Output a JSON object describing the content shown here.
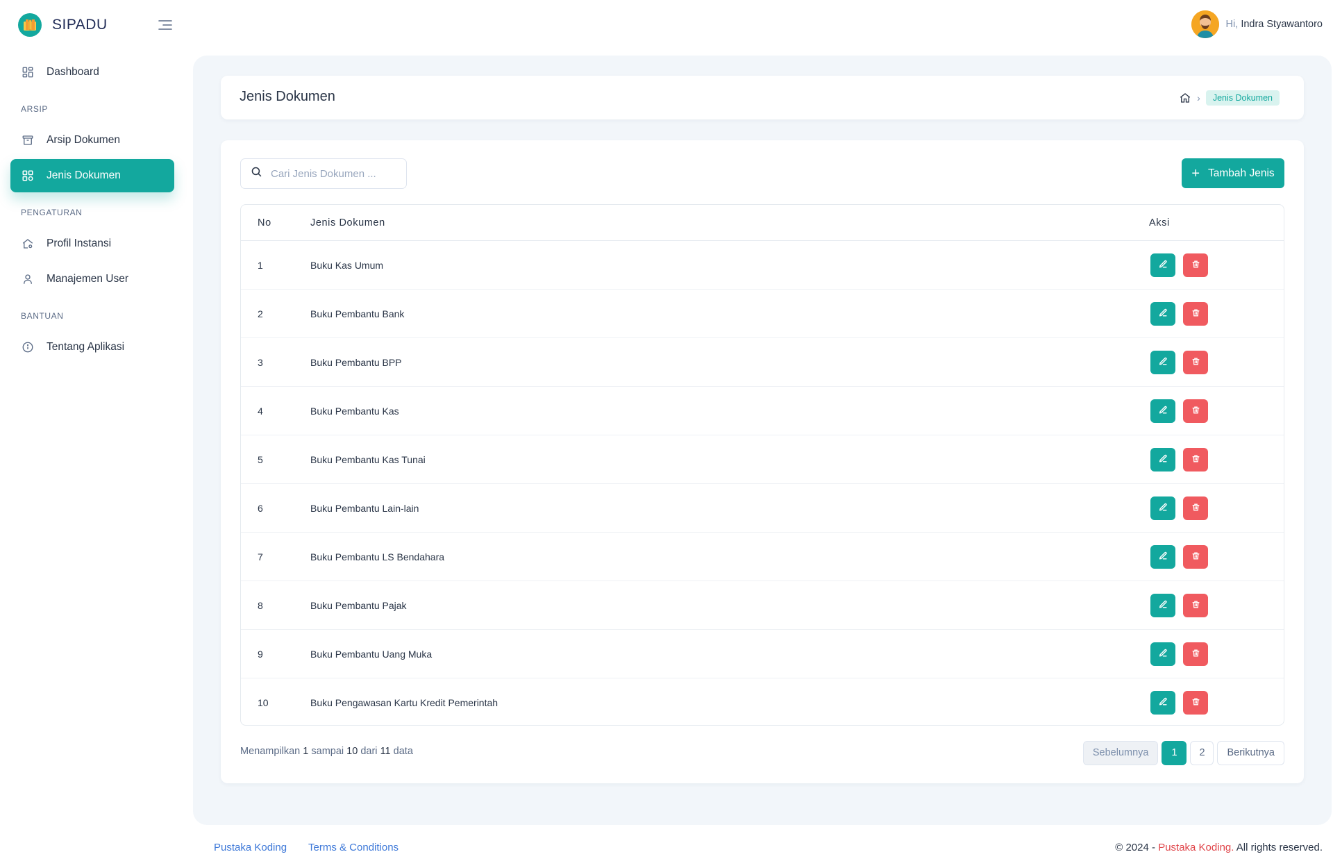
{
  "app": {
    "name": "SIPADU"
  },
  "header": {
    "greeting": "Hi,",
    "user_name": "Indra Styawantoro"
  },
  "sidebar": {
    "dashboard": "Dashboard",
    "sections": {
      "arsip": "ARSIP",
      "pengaturan": "PENGATURAN",
      "bantuan": "BANTUAN"
    },
    "items": {
      "arsip_dokumen": "Arsip Dokumen",
      "jenis_dokumen": "Jenis Dokumen",
      "profil_instansi": "Profil Instansi",
      "manajemen_user": "Manajemen User",
      "tentang_aplikasi": "Tentang Aplikasi"
    }
  },
  "page": {
    "title": "Jenis Dokumen",
    "breadcrumb_current": "Jenis Dokumen"
  },
  "search": {
    "placeholder": "Cari Jenis Dokumen ..."
  },
  "toolbar": {
    "add_icon": "+",
    "add_label": "Tambah Jenis"
  },
  "table": {
    "headers": {
      "no": "No",
      "name": "Jenis Dokumen",
      "action": "Aksi"
    },
    "rows": [
      {
        "no": "1",
        "name": "Buku Kas Umum"
      },
      {
        "no": "2",
        "name": "Buku Pembantu Bank"
      },
      {
        "no": "3",
        "name": "Buku Pembantu BPP"
      },
      {
        "no": "4",
        "name": "Buku Pembantu Kas"
      },
      {
        "no": "5",
        "name": "Buku Pembantu Kas Tunai"
      },
      {
        "no": "6",
        "name": "Buku Pembantu Lain-lain"
      },
      {
        "no": "7",
        "name": "Buku Pembantu LS Bendahara"
      },
      {
        "no": "8",
        "name": "Buku Pembantu Pajak"
      },
      {
        "no": "9",
        "name": "Buku Pembantu Uang Muka"
      },
      {
        "no": "10",
        "name": "Buku Pengawasan Kartu Kredit Pemerintah"
      }
    ]
  },
  "pagination_info": {
    "prefix": "Menampilkan",
    "from": "1",
    "mid1": "sampai",
    "to": "10",
    "mid2": "dari",
    "total": "11",
    "suffix": "data"
  },
  "pagination": {
    "prev": "Sebelumnya",
    "page1": "1",
    "page2": "2",
    "next": "Berikutnya"
  },
  "footer": {
    "link1": "Pustaka Koding",
    "link2": "Terms & Conditions",
    "copy_prefix": "© 2024 -",
    "copy_brand": "Pustaka Koding.",
    "copy_suffix": "All rights reserved."
  },
  "colors": {
    "primary": "#13a89e",
    "danger": "#f05a5f",
    "link": "#3d78d8",
    "content_bg": "#f2f6fa"
  },
  "icons": {
    "brand": "archive-logo-icon",
    "menu": "menu-toggle-icon",
    "dashboard": "dashboard-icon",
    "arsip": "archive-box-icon",
    "jenis": "grid-icon",
    "profil": "home-settings-icon",
    "user": "user-icon",
    "info": "info-icon",
    "search": "search-icon",
    "home": "home-icon",
    "edit": "edit-icon",
    "delete": "trash-icon"
  }
}
